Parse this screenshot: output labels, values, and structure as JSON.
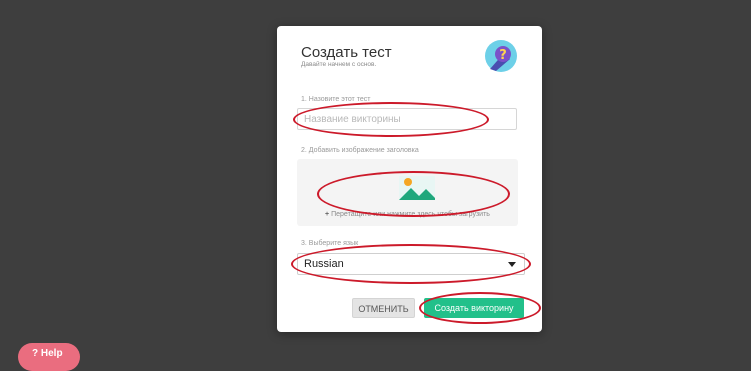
{
  "dialog": {
    "title": "Создать тест",
    "subtitle": "Давайте начнем с основ."
  },
  "quiz_name": {
    "label": "1. Назовите этот тест",
    "placeholder": "Название викторины",
    "value": ""
  },
  "header_image": {
    "label": "2. Добавить изображение заголовка",
    "upload_prefix": "+",
    "upload_text": "Перетащите или нажмите здесь чтобы загрузить"
  },
  "language": {
    "label": "3. Выберите язык",
    "selected": "Russian"
  },
  "actions": {
    "cancel_label": "ОТМЕНИТЬ",
    "create_label": "Создать викторину"
  },
  "help": {
    "label": "Help"
  },
  "colors": {
    "background": "#3e3e3e",
    "accent_green": "#22c08a",
    "annotation_red": "#cc1a2a",
    "help_pink": "#ea6d7f"
  },
  "icons": {
    "quiz": "quiz-question-icon",
    "image": "image-landscape-icon",
    "dropdown": "caret-down-icon",
    "help": "help-circle-icon"
  }
}
